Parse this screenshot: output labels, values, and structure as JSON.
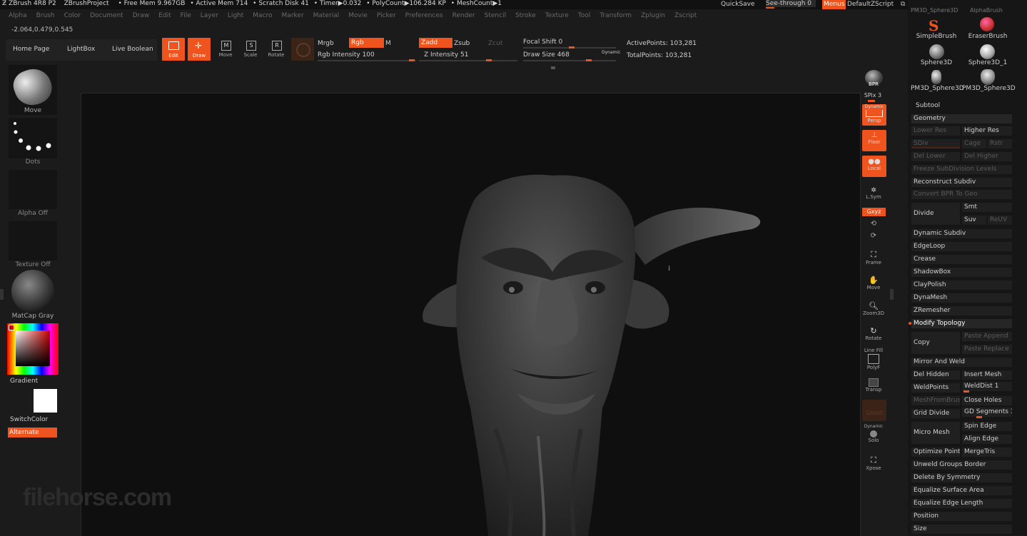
{
  "titlebar": {
    "app": "ZBrush 4R8 P2",
    "project": "ZBrushProject",
    "free_mem": "• Free Mem 9.967GB",
    "active_mem": "• Active Mem 714",
    "scratch": "• Scratch Disk 41",
    "timer": "• Timer▶0.032",
    "polycount": "• PolyCount▶106.284 KP",
    "meshcount": "• MeshCount▶1",
    "quicksave": "QuickSave",
    "seethrough": "See-through  0",
    "menus": "Menus",
    "script": "DefaultZScript"
  },
  "menubar": [
    "Alpha",
    "Brush",
    "Color",
    "Document",
    "Draw",
    "Edit",
    "File",
    "Layer",
    "Light",
    "Macro",
    "Marker",
    "Material",
    "Movie",
    "Picker",
    "Preferences",
    "Render",
    "Stencil",
    "Stroke",
    "Texture",
    "Tool",
    "Transform",
    "Zplugin",
    "Zscript"
  ],
  "coords": "-2.064,0.479,0.545",
  "toolbar": {
    "home": "Home Page",
    "lightbox": "LightBox",
    "liveboolean": "Live Boolean",
    "edit": "Edit",
    "draw": "Draw",
    "move": "Move",
    "scale": "Scale",
    "rotate": "Rotate",
    "mrgb": "Mrgb",
    "rgb": "Rgb",
    "m": "M",
    "rgb_intensity": "Rgb Intensity 100",
    "zadd": "Zadd",
    "zsub": "Zsub",
    "zcut": "Zcut",
    "z_intensity": "Z Intensity 51",
    "focal_shift": "Focal Shift 0",
    "draw_size": "Draw Size 468",
    "dynamic": "Dynamic",
    "active_points": "ActivePoints: 103,281",
    "total_points": "TotalPoints: 103,281"
  },
  "left_shelf": {
    "move": "Move",
    "dots": "Dots",
    "alpha_off": "Alpha Off",
    "texture_off": "Texture Off",
    "matcap": "MatCap Gray",
    "gradient": "Gradient",
    "switchcolor": "SwitchColor",
    "alternate": "Alternate"
  },
  "right_toolbar": {
    "bpr": "BPR",
    "spix": "SPix 3",
    "dynamic": "Dynamic",
    "persp": "Persp",
    "floor": "Floor",
    "local": "Local",
    "lsym": "L.Sym",
    "xyz": "Gxyz",
    "frame": "Frame",
    "move": "Move",
    "zoom3d": "Zoom3D",
    "rotate": "Rotate",
    "linefill": "Line Fill",
    "polyf": "PolyF",
    "transp": "Transp",
    "ghost": "Ghost",
    "dynamic2": "Dynamic",
    "solo": "Solo",
    "xpose": "Xpose"
  },
  "tool_palette": {
    "thumbs": [
      {
        "label": "SimpleBrush"
      },
      {
        "label": "EraserBrush"
      },
      {
        "label": "Sphere3D"
      },
      {
        "label": "Sphere3D_1"
      },
      {
        "label": "PM3D_Sphere3D"
      },
      {
        "label": "PM3D_Sphere3D"
      }
    ],
    "top_cut_left": "PM3D_Sphere3D",
    "top_cut_right": "AlphaBrush",
    "subtool": "Subtool",
    "geometry": "Geometry",
    "lower_res": "Lower Res",
    "higher_res": "Higher Res",
    "sdiv": "SDiv",
    "cage": "Cage",
    "rstr": "Rstr",
    "del_lower": "Del Lower",
    "del_higher": "Del Higher",
    "freeze": "Freeze SubDivision Levels",
    "reconstruct": "Reconstruct Subdiv",
    "convert_bpr": "Convert BPR To Geo",
    "divide": "Divide",
    "smt": "Smt",
    "suv": "Suv",
    "reuv": "ReUV",
    "dynamic_subdiv": "Dynamic Subdiv",
    "edgeloop": "EdgeLoop",
    "crease": "Crease",
    "shadowbox": "ShadowBox",
    "claypolish": "ClayPolish",
    "dynamesh": "DynaMesh",
    "zremesher": "ZRemesher",
    "modify_topology": "Modify Topology",
    "copy": "Copy",
    "paste_append": "Paste Append",
    "paste_replace": "Paste Replace",
    "mirror_weld": "Mirror And Weld",
    "del_hidden": "Del Hidden",
    "insert_mesh": "Insert Mesh",
    "weldpoints": "WeldPoints",
    "welddist": "WeldDist 1",
    "meshfrombrush": "MeshFromBrush",
    "close_holes": "Close Holes",
    "grid_divide": "Grid Divide",
    "gd_segments": "GD Segments 3",
    "spin_edge": "Spin Edge",
    "micro_mesh": "Micro Mesh",
    "align_edge": "Align Edge",
    "optimize_points": "Optimize Points",
    "mergetris": "MergeTris",
    "unweld_groups": "Unweld Groups Border",
    "delete_symmetry": "Delete By Symmetry",
    "equalize_area": "Equalize Surface Area",
    "equalize_edge": "Equalize Edge Length",
    "position": "Position",
    "size": "Size"
  },
  "watermark": "filehorse.com",
  "colors": {
    "accent": "#f0541e",
    "background": "#1b1b1b",
    "canvas": "#0f0f0f"
  }
}
